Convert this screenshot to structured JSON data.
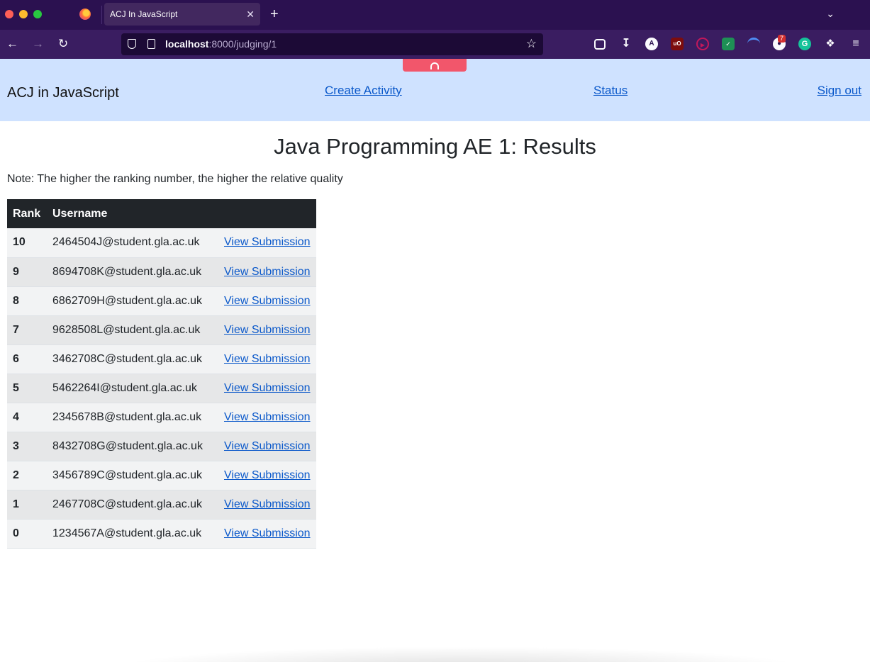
{
  "browser": {
    "tab_title": "ACJ In JavaScript",
    "tab_close": "✕",
    "new_tab": "+",
    "url_host": "localhost",
    "url_rest": ":8000/judging/1",
    "extension_badge": "7"
  },
  "header": {
    "brand": "ACJ in JavaScript",
    "links": {
      "create": "Create Activity",
      "status": "Status",
      "signout": "Sign out"
    }
  },
  "page": {
    "title": "Java Programming AE 1: Results",
    "note": "Note: The higher the ranking number, the higher the relative quality"
  },
  "table": {
    "columns": [
      "Rank",
      "Username",
      ""
    ],
    "rows": [
      {
        "rank": "10",
        "username": "2464504J@student.gla.ac.uk",
        "action": "View Submission"
      },
      {
        "rank": "9",
        "username": "8694708K@student.gla.ac.uk",
        "action": "View Submission"
      },
      {
        "rank": "8",
        "username": "6862709H@student.gla.ac.uk",
        "action": "View Submission"
      },
      {
        "rank": "7",
        "username": "9628508L@student.gla.ac.uk",
        "action": "View Submission"
      },
      {
        "rank": "6",
        "username": "3462708C@student.gla.ac.uk",
        "action": "View Submission"
      },
      {
        "rank": "5",
        "username": "5462264I@student.gla.ac.uk",
        "action": "View Submission"
      },
      {
        "rank": "4",
        "username": "2345678B@student.gla.ac.uk",
        "action": "View Submission"
      },
      {
        "rank": "3",
        "username": "8432708G@student.gla.ac.uk",
        "action": "View Submission"
      },
      {
        "rank": "2",
        "username": "3456789C@student.gla.ac.uk",
        "action": "View Submission"
      },
      {
        "rank": "1",
        "username": "2467708C@student.gla.ac.uk",
        "action": "View Submission"
      },
      {
        "rank": "0",
        "username": "1234567A@student.gla.ac.uk",
        "action": "View Submission"
      }
    ]
  },
  "colors": {
    "header_bg": "#cfe2ff",
    "table_head_bg": "#212529",
    "link": "#0a58ca",
    "browser_frame": "#2b1150"
  }
}
